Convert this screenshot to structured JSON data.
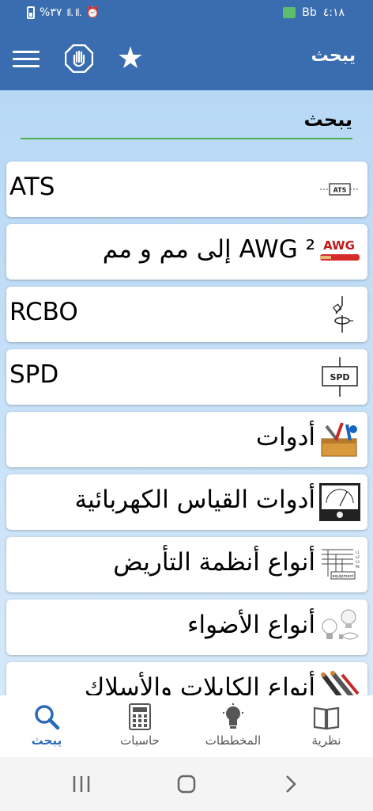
{
  "status_bar": {
    "battery_pct": "%٣٧",
    "signal": "Il. Il.",
    "carrier": "Bb",
    "time": "٤:١٨"
  },
  "app_bar": {
    "title": "يبحث"
  },
  "search": {
    "value": "يبحث"
  },
  "items": [
    {
      "label": "ATS",
      "icon": "ats-icon",
      "icon_text": "ATS"
    },
    {
      "label": "AWG ² إلى مم و مم",
      "icon": "awg-icon",
      "icon_text": "AWG"
    },
    {
      "label": "RCBO",
      "icon": "rcbo-icon"
    },
    {
      "label": "SPD",
      "icon": "spd-icon",
      "icon_text": "SPD"
    },
    {
      "label": "أدوات",
      "icon": "toolbox-icon"
    },
    {
      "label": "أدوات القياس الكهربائية",
      "icon": "meter-icon"
    },
    {
      "label": "أنواع أنظمة التأريض",
      "icon": "grounding-icon",
      "icon_text": "equipment"
    },
    {
      "label": "أنواع الأضواء",
      "icon": "lamps-icon"
    },
    {
      "label": "أنواع الكابلات والأسلاك",
      "icon": "cables-icon"
    }
  ],
  "bottom_nav": [
    {
      "label": "يبحث",
      "icon": "search-icon",
      "active": true
    },
    {
      "label": "حاسبات",
      "icon": "calculator-icon"
    },
    {
      "label": "المخططات",
      "icon": "lightbulb-icon"
    },
    {
      "label": "نظرية",
      "icon": "book-icon"
    }
  ],
  "colors": {
    "app_bar": "#3a6db0",
    "accent_underline": "#4caf50",
    "active_nav": "#2c69b8"
  }
}
